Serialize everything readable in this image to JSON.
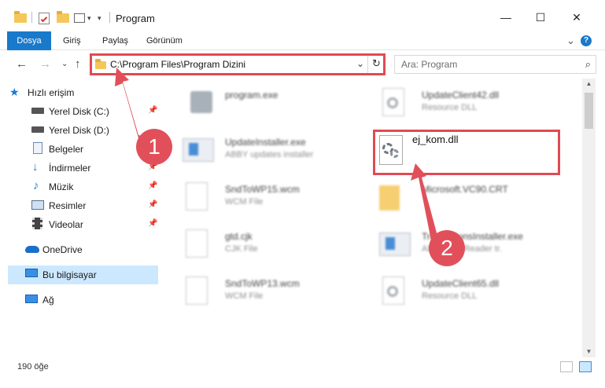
{
  "window": {
    "title": "Program",
    "minimize_glyph": "—",
    "maximize_glyph": "☐",
    "close_glyph": "✕"
  },
  "ribbon": {
    "tabs": [
      {
        "label": "Dosya"
      },
      {
        "label": "Giriş"
      },
      {
        "label": "Paylaş"
      },
      {
        "label": "Görünüm"
      }
    ],
    "help_glyph": "?",
    "expand_glyph": "⌄"
  },
  "address": {
    "path": "C:\\Program Files\\Program Dizini",
    "dropdown_glyph": "⌄",
    "refresh_glyph": "↻"
  },
  "search": {
    "placeholder": "Ara: Program",
    "icon_glyph": "⌕"
  },
  "navigation": {
    "back_glyph": "←",
    "forward_glyph": "→",
    "recent_glyph": "⌄",
    "up_glyph": "↑"
  },
  "sidebar": {
    "quick_access": "Hızlı erişim",
    "items": [
      {
        "label": "Yerel Disk (C:)",
        "pinned": true,
        "icon": "drive-icon"
      },
      {
        "label": "Yerel Disk (D:)",
        "pinned": false,
        "icon": "drive-icon"
      },
      {
        "label": "Belgeler",
        "pinned": true,
        "icon": "documents-icon"
      },
      {
        "label": "İndirmeler",
        "pinned": true,
        "icon": "downloads-icon"
      },
      {
        "label": "Müzik",
        "pinned": true,
        "icon": "music-icon"
      },
      {
        "label": "Resimler",
        "pinned": true,
        "icon": "pictures-icon"
      },
      {
        "label": "Videolar",
        "pinned": true,
        "icon": "videos-icon"
      }
    ],
    "onedrive": "OneDrive",
    "this_pc": "Bu bilgisayar",
    "network": "Ağ",
    "pin_glyph": "📌"
  },
  "files": [
    {
      "name": "program.exe",
      "type": ""
    },
    {
      "name": "UpdateClient42.dll",
      "type": "Resource DLL"
    },
    {
      "name": "UpdateInstaller.exe",
      "type": "ABBY updates installer"
    },
    {
      "name": "ej_kom.dll",
      "type": ""
    },
    {
      "name": "SndToWP15.wcm",
      "type": "WCM File"
    },
    {
      "name": "Microsoft.VC90.CRT",
      "type": ""
    },
    {
      "name": "gtd.cjk",
      "type": "CJK File"
    },
    {
      "name": "TranslationsInstaller.exe",
      "type": "ABBY FineReader tr."
    },
    {
      "name": "SndToWP13.wcm",
      "type": "WCM File"
    },
    {
      "name": "UpdateClient65.dll",
      "type": "Resource DLL"
    }
  ],
  "status": {
    "item_count": "190 öğe"
  },
  "annotations": {
    "badge1": "1",
    "badge2": "2"
  },
  "colors": {
    "accent": "#1979ca",
    "selection": "#cce8ff",
    "annotation_red": "#e14a52",
    "folder_yellow": "#f5c75a"
  }
}
